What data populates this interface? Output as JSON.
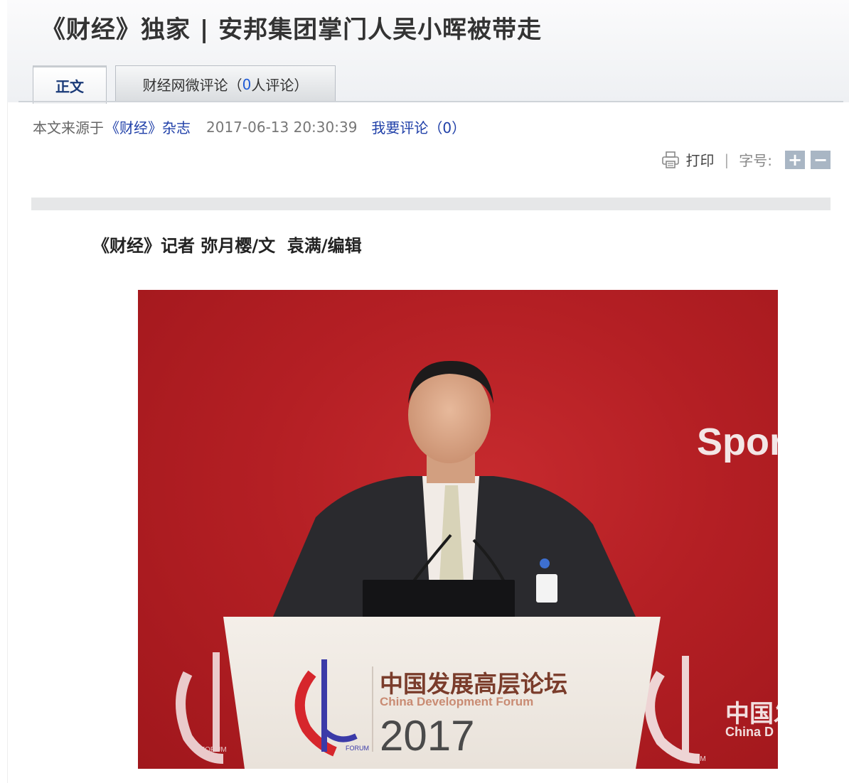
{
  "article": {
    "title": "《财经》独家 | 安邦集团掌门人吴小晖被带走",
    "byline": "《财经》记者 弥月樱/文  袁满/编辑"
  },
  "tabs": [
    {
      "label": "正文",
      "active": true
    },
    {
      "label_prefix": "财经网微评论（",
      "count": "0",
      "label_suffix": "人评论）",
      "active": false
    }
  ],
  "meta": {
    "source_prefix": "本文来源于",
    "source_link": "《财经》杂志",
    "datetime": "2017-06-13 20:30:39",
    "comment_link": "我要评论（0）"
  },
  "toolbar": {
    "print_label": "打印",
    "separator": "|",
    "font_size_label": "字号:",
    "increase_label": "+",
    "decrease_label": "−"
  },
  "photo": {
    "backdrop_text": "Spor",
    "podium_title_cn": "中国发展高层论坛",
    "podium_title_en": "China Development Forum",
    "podium_year": "2017",
    "forum_small": "FORUM",
    "side_cn": "中国发",
    "side_en": "China D"
  },
  "colors": {
    "link": "#1f3fa8",
    "tab_active_text": "#1a3a78",
    "count_highlight": "#1f5bd6",
    "backdrop_red": "#b41f24"
  }
}
